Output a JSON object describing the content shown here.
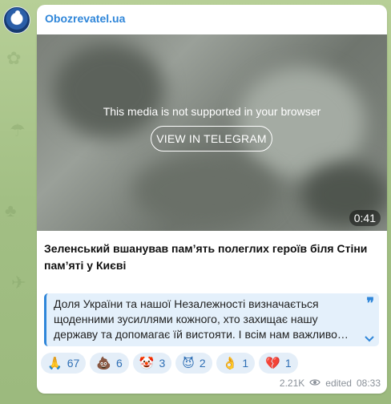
{
  "channel": {
    "name": "Obozrevatel.ua",
    "avatar_icon": "channel-avatar"
  },
  "media": {
    "message": "This media is not supported in your browser",
    "button_label": "VIEW IN TELEGRAM",
    "duration": "0:41"
  },
  "post": {
    "headline": "Зеленський вшанував пам’ять полеглих героїв біля Стіни пам’яті у Києві",
    "quote": "Доля України та нашої Незалежності визначається щоденними зусиллями кожного, хто захищає нашу державу та допомагає їй вистояти. І всім нам важливо…",
    "quote_mark": "❞",
    "expand_icon": "chevron-down-icon"
  },
  "reactions": [
    {
      "emoji": "🙏",
      "count": "67"
    },
    {
      "emoji": "💩",
      "count": "6"
    },
    {
      "emoji": "🤡",
      "count": "3"
    },
    {
      "emoji": "😈",
      "count": "2"
    },
    {
      "emoji": "👌",
      "count": "1"
    },
    {
      "emoji": "💔",
      "count": "1"
    }
  ],
  "meta": {
    "views": "2.21K",
    "views_icon": "eye-icon",
    "edited": "edited",
    "time": "08:33"
  },
  "colors": {
    "accent": "#2f86d9",
    "bubble": "#ffffff",
    "quote_bg": "#e4f0fb"
  }
}
